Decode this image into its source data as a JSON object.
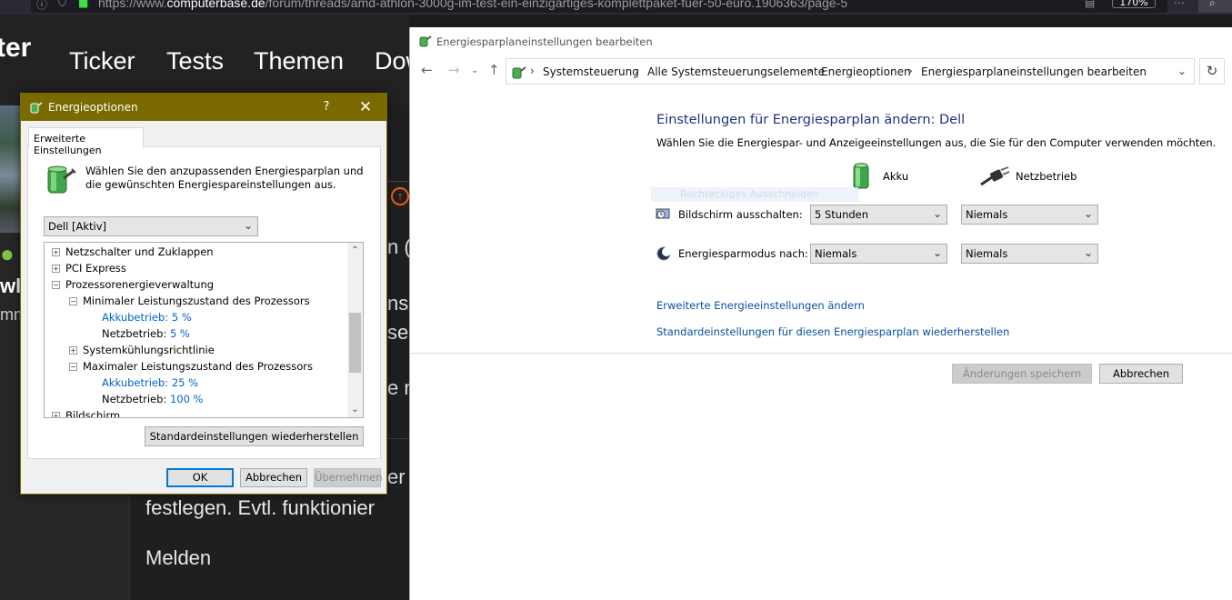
{
  "browser": {
    "url_prefix": "https://www.",
    "url_domain": "computerbase.de",
    "url_rest": "/forum/threads/amd-athlon-3000g-im-test-ein-einzigartiges-komplettpaket-fuer-50-euro.1906363/page-5",
    "zoom": "170%"
  },
  "site": {
    "logo_fragment": "ter",
    "nav": [
      "Ticker",
      "Tests",
      "Themen",
      "Dow"
    ],
    "user_fragment_1": "wl",
    "user_fragment_2": "mm",
    "text_fragments": [
      "n (",
      "ns",
      "sei",
      "e m",
      "er"
    ],
    "body_text": "festlegen. Evtl. funktionier",
    "report_link": "Melden"
  },
  "eo_dialog": {
    "title": "Energieoptionen",
    "help": "?",
    "close": "✕",
    "tab": "Erweiterte Einstellungen",
    "description": "Wählen Sie den anzupassenden Energiesparplan und die gewünschten Energiespareinstellungen aus.",
    "plan_select": "Dell [Aktiv]",
    "tree": [
      {
        "label": "Netzschalter und Zuklappen",
        "expander": "+"
      },
      {
        "label": "PCI Express",
        "expander": "+"
      },
      {
        "label": "Prozessorenergieverwaltung",
        "expander": "−"
      },
      {
        "label": "Minimaler Leistungszustand des Prozessors",
        "expander": "−"
      },
      {
        "label": "Akkubetrieb:",
        "value": "5 %"
      },
      {
        "label": "Netzbetrieb:",
        "value": "5 %"
      },
      {
        "label": "Systemkühlungsrichtlinie",
        "expander": "+"
      },
      {
        "label": "Maximaler Leistungszustand des Prozessors",
        "expander": "−"
      },
      {
        "label": "Akkubetrieb:",
        "value": "25 %"
      },
      {
        "label": "Netzbetrieb:",
        "value": "100 %"
      },
      {
        "label": "Bildschirm",
        "expander": "+"
      }
    ],
    "restore_button": "Standardeinstellungen wiederherstellen",
    "ok": "OK",
    "cancel": "Abbrechen",
    "apply": "Übernehmen"
  },
  "cp_window": {
    "title": "Energiesparplaneinstellungen bearbeiten",
    "breadcrumbs": [
      "Systemsteuerung",
      "Alle Systemsteuerungselemente",
      "Energieoptionen",
      "Energiesparplaneinstellungen bearbeiten"
    ],
    "heading": "Einstellungen für Energiesparplan ändern: Dell",
    "subheading": "Wählen Sie die Energiespar- und Anzeigeeinstellungen aus, die Sie für den Computer verwenden möchten.",
    "col_battery": "Akku",
    "col_ac": "Netzbetrieb",
    "ghost_text": "Rechteckiges Ausschneiden",
    "settings": [
      {
        "label": "Bildschirm ausschalten:",
        "battery": "5 Stunden",
        "ac": "Niemals"
      },
      {
        "label": "Energiesparmodus nach:",
        "battery": "Niemals",
        "ac": "Niemals"
      }
    ],
    "link_advanced": "Erweiterte Energieeinstellungen ändern",
    "link_restore": "Standardeinstellungen für diesen Energiesparplan wiederherstellen",
    "save": "Änderungen speichern",
    "cancel": "Abbrechen"
  }
}
